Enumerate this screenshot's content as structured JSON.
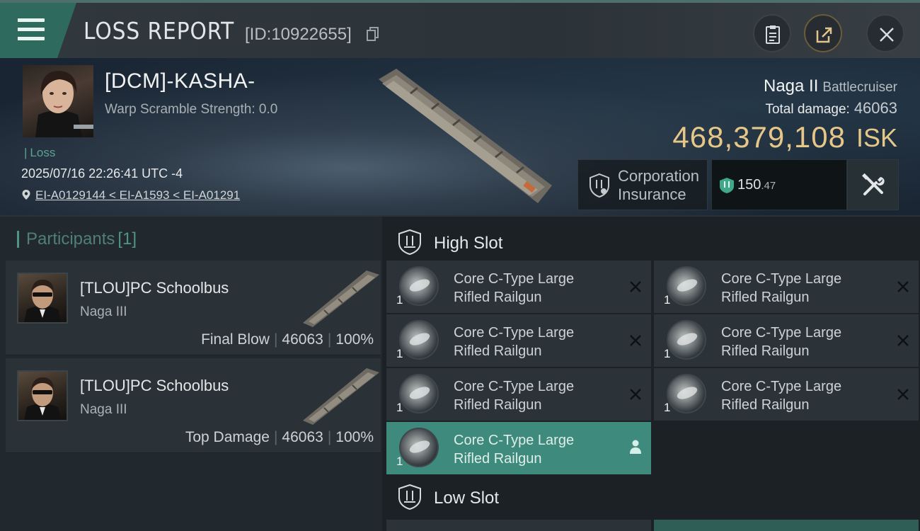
{
  "header": {
    "title": "LOSS REPORT",
    "report_id": "[ID:10922655]"
  },
  "victim": {
    "name": "[DCM]-KASHA-",
    "warp_scramble": "Warp Scramble Strength: 0.0",
    "status": "Loss",
    "datetime": "2025/07/16 22:26:41 UTC -4",
    "location": "EI-A0129144 < EI-A1593 < EI-A01291"
  },
  "ship": {
    "name": "Naga II",
    "class": "Battlecruiser",
    "total_damage_label": "Total damage:",
    "total_damage": "46063",
    "isk_value": "468,379,108",
    "isk_unit": "ISK"
  },
  "insurance": {
    "label_line1": "Corporation",
    "label_line2": "Insurance",
    "amount_int": "150",
    "amount_dec": ".47"
  },
  "participants": {
    "title": "Participants",
    "count": "[1]",
    "rows": [
      {
        "name": "[TLOU]PC Schoolbus",
        "ship": "Naga III",
        "role": "Final Blow",
        "damage": "46063",
        "percent": "100%"
      },
      {
        "name": "[TLOU]PC Schoolbus",
        "ship": "Naga III",
        "role": "Top Damage",
        "damage": "46063",
        "percent": "100%"
      }
    ]
  },
  "high_slot": {
    "title": "High Slot",
    "modules": [
      {
        "qty": "1",
        "line1": "Core C-Type Large",
        "line2": "Rifled Railgun",
        "state": "destroyed"
      },
      {
        "qty": "1",
        "line1": "Core C-Type Large",
        "line2": "Rifled Railgun",
        "state": "destroyed"
      },
      {
        "qty": "1",
        "line1": "Core C-Type Large",
        "line2": "Rifled Railgun",
        "state": "destroyed"
      },
      {
        "qty": "1",
        "line1": "Core C-Type Large",
        "line2": "Rifled Railgun",
        "state": "destroyed"
      },
      {
        "qty": "1",
        "line1": "Core C-Type Large",
        "line2": "Rifled Railgun",
        "state": "destroyed"
      },
      {
        "qty": "1",
        "line1": "Core C-Type Large",
        "line2": "Rifled Railgun",
        "state": "destroyed"
      },
      {
        "qty": "1",
        "line1": "Core C-Type Large",
        "line2": "Rifled Railgun",
        "state": "dropped"
      }
    ]
  },
  "low_slot": {
    "title": "Low Slot"
  },
  "colors": {
    "accent": "#3e8a7c",
    "isk_gold": "#e6c788",
    "loss_green": "#5aa393"
  }
}
